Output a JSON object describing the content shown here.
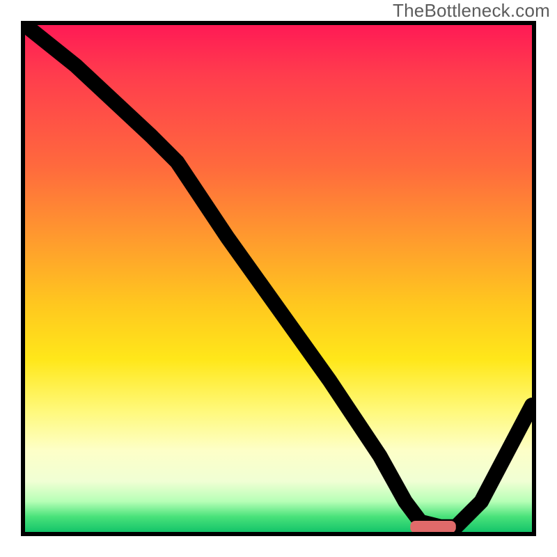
{
  "watermark": "TheBottleneck.com",
  "chart_data": {
    "type": "line",
    "title": "",
    "xlabel": "",
    "ylabel": "",
    "xlim": [
      0,
      100
    ],
    "ylim": [
      0,
      100
    ],
    "grid": false,
    "series": [
      {
        "name": "bottleneck-curve",
        "x": [
          0,
          10,
          25,
          30,
          40,
          50,
          60,
          70,
          75,
          78,
          82,
          85,
          90,
          100
        ],
        "values": [
          100,
          92,
          78,
          73,
          58,
          44,
          30,
          15,
          6,
          2,
          1,
          1,
          6,
          25
        ]
      }
    ],
    "marker": {
      "name": "optimal-range",
      "x_start": 76,
      "x_end": 85,
      "y": 1
    },
    "background_gradient": {
      "stops": [
        {
          "pos": 0,
          "color": "#ff1a55"
        },
        {
          "pos": 10,
          "color": "#ff3d4d"
        },
        {
          "pos": 28,
          "color": "#ff6a3d"
        },
        {
          "pos": 42,
          "color": "#ff9a2e"
        },
        {
          "pos": 55,
          "color": "#ffc71f"
        },
        {
          "pos": 66,
          "color": "#ffe71a"
        },
        {
          "pos": 76,
          "color": "#fff97a"
        },
        {
          "pos": 84,
          "color": "#fdffc8"
        },
        {
          "pos": 90,
          "color": "#f0ffd4"
        },
        {
          "pos": 94,
          "color": "#b6ffb6"
        },
        {
          "pos": 97,
          "color": "#49e27a"
        },
        {
          "pos": 100,
          "color": "#14c46a"
        }
      ]
    }
  }
}
